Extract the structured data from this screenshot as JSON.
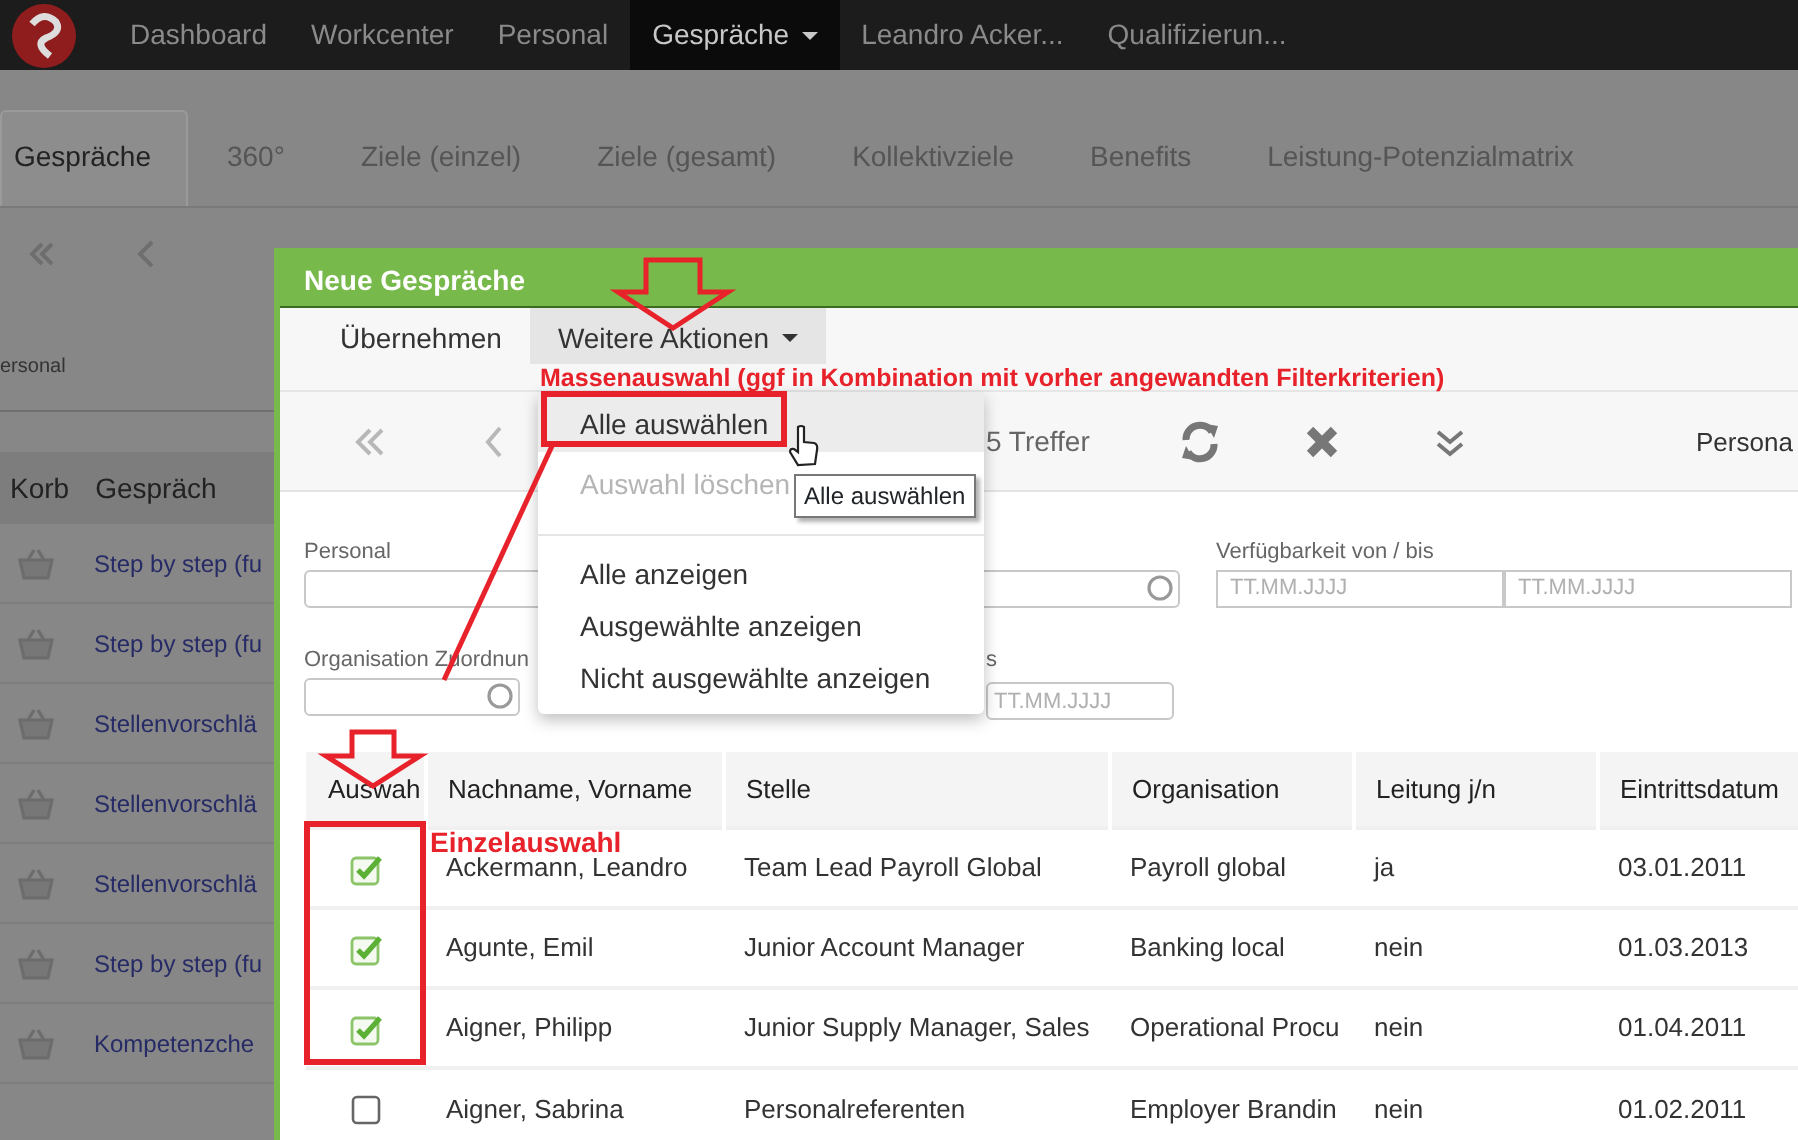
{
  "navbar": {
    "items": [
      {
        "label": "Dashboard",
        "selected": false,
        "has_menu": false
      },
      {
        "label": "Workcenter",
        "selected": false,
        "has_menu": false
      },
      {
        "label": "Personal",
        "selected": false,
        "has_menu": false
      },
      {
        "label": "Gespräche",
        "selected": true,
        "has_menu": true
      },
      {
        "label": "Leandro Acker...",
        "selected": false,
        "has_menu": false
      },
      {
        "label": "Qualifizierun...",
        "selected": false,
        "has_menu": false
      }
    ]
  },
  "tabs": [
    {
      "label": "Gespräche",
      "selected": true
    },
    {
      "label": "360°",
      "selected": false
    },
    {
      "label": "Ziele (einzel)",
      "selected": false
    },
    {
      "label": "Ziele (gesamt)",
      "selected": false
    },
    {
      "label": "Kollektivziele",
      "selected": false
    },
    {
      "label": "Benefits",
      "selected": false
    },
    {
      "label": "Leistung-Potenzialmatrix",
      "selected": false
    }
  ],
  "background_filter": {
    "label": "ersonal"
  },
  "background_table": {
    "columns": [
      "Korb",
      "Gespräch"
    ],
    "rows": [
      "Step by step (fu",
      "Step by step (fu",
      "Stellenvorschlä",
      "Stellenvorschlä",
      "Stellenvorschlä",
      "Step by step (fu",
      "Kompetenzche"
    ]
  },
  "dialog": {
    "title": "Neue Gespräche",
    "menu": [
      {
        "label": "Übernehmen",
        "selected": false,
        "has_menu": false
      },
      {
        "label": "Weitere Aktionen",
        "selected": true,
        "has_menu": true
      }
    ],
    "toolbar": {
      "hits": "5 Treffer",
      "right_label": "Persona"
    },
    "filters": [
      {
        "kind": "lookup",
        "label": "Personal"
      },
      {
        "kind": "daterange",
        "label": "Verfügbarkeit von / bis",
        "placeholder_from": "TT.MM.JJJJ",
        "placeholder_to": "TT.MM.JJJJ"
      },
      {
        "kind": "lookup",
        "label": "Organisation Zuordnun"
      },
      {
        "kind": "date",
        "label": "s",
        "placeholder": "TT.MM.JJJJ"
      }
    ],
    "table": {
      "selection_column": "Auswah",
      "columns": [
        "Nachname, Vorname",
        "Stelle",
        "Organisation",
        "Leitung j/n",
        "Eintrittsdatum"
      ],
      "rows": [
        {
          "selected": true,
          "cells": [
            "Ackermann, Leandro",
            "Team Lead Payroll Global",
            "Payroll global",
            "ja",
            "03.01.2011"
          ]
        },
        {
          "selected": true,
          "cells": [
            "Agunte, Emil",
            "Junior Account Manager",
            "Banking local",
            "nein",
            "01.03.2013"
          ]
        },
        {
          "selected": true,
          "cells": [
            "Aigner, Philipp",
            "Junior Supply Manager, Sales",
            "Operational Procu",
            "nein",
            "01.04.2011"
          ]
        },
        {
          "selected": false,
          "cells": [
            "Aigner, Sabrina",
            "Personalreferenten",
            "Employer Brandin",
            "nein",
            "01.02.2011"
          ]
        }
      ]
    }
  },
  "dropdown": {
    "items": [
      {
        "kind": "item",
        "label": "Alle auswählen",
        "hovered": true,
        "disabled": false
      },
      {
        "kind": "item",
        "label": "Auswahl löschen",
        "hovered": false,
        "disabled": true
      },
      {
        "kind": "divider"
      },
      {
        "kind": "item",
        "label": "Alle anzeigen",
        "hovered": false,
        "disabled": false
      },
      {
        "kind": "item",
        "label": "Ausgewählte anzeigen",
        "hovered": false,
        "disabled": false
      },
      {
        "kind": "item",
        "label": "Nicht ausgewählte anzeigen",
        "hovered": false,
        "disabled": false
      }
    ]
  },
  "tooltip": "Alle auswählen",
  "annotations": [
    {
      "kind": "mass",
      "text": "Massenauswahl (ggf in Kombination mit vorher angewandten Filterkriterien)"
    },
    {
      "kind": "single",
      "text": "Einzelauswahl"
    }
  ]
}
